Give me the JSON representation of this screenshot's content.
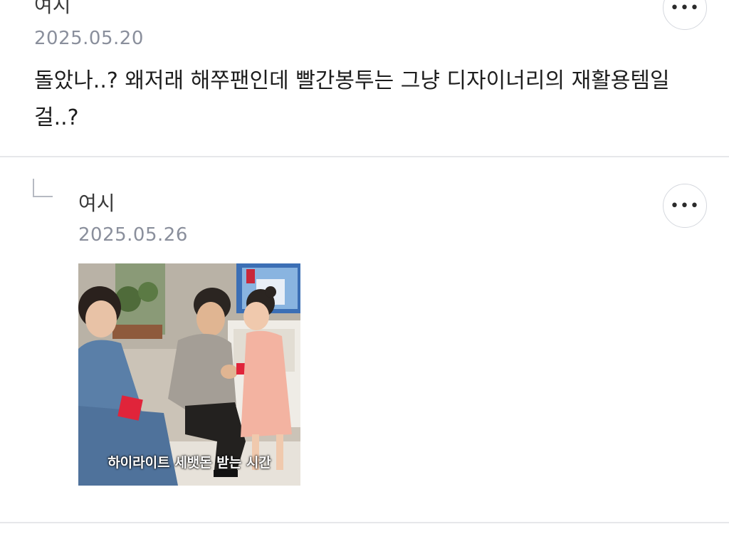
{
  "comments": [
    {
      "author": "여시",
      "date": "2025.05.20",
      "text": "돌았나..? 왜저래 해쭈팬인데 빨간봉투는 그냥 디자이너리의 재활용템일걸..?",
      "more_label": "•••"
    }
  ],
  "reply": {
    "author": "여시",
    "date": "2025.05.26",
    "more_label": "•••",
    "image": {
      "caption": "하이라이트 세뱃돈 받는 시간"
    }
  },
  "colors": {
    "date_gray": "#8a8f9c",
    "divider": "#e6e7ea",
    "envelope_red": "#e0243a"
  },
  "icons": [
    "more-options-icon",
    "reply-arrow-icon"
  ]
}
